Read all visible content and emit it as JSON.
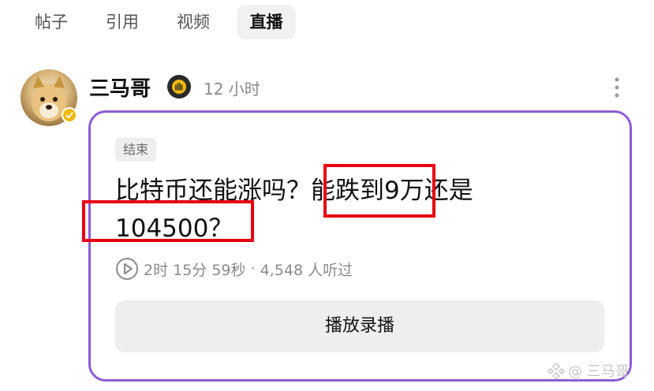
{
  "tabs": [
    {
      "label": "帖子",
      "active": false
    },
    {
      "label": "引用",
      "active": false
    },
    {
      "label": "视频",
      "active": false
    },
    {
      "label": "直播",
      "active": true
    }
  ],
  "post": {
    "author": "三马哥",
    "time": "12 小时",
    "avatar_icon": "doge-avatar",
    "verified_icon": "check-icon",
    "badge_icon": "hand-badge-icon",
    "more_icon": "more-vertical-icon"
  },
  "live": {
    "status": "结束",
    "title_line1": "比特币还能涨吗？能跌到9万还是",
    "title_line2": "104500？",
    "duration": "2时 15分 59秒",
    "separator": " · ",
    "listeners": "4,548 人听过",
    "play_icon": "play-circle-icon",
    "replay_button": "播放录播"
  },
  "watermark": {
    "icon": "binance-logo-icon",
    "text": "@ 三马哥"
  },
  "colors": {
    "card_border": "#8b5cd6",
    "highlight": "#e60012",
    "muted": "#8a8a8a",
    "button_bg": "#eeeeee"
  }
}
